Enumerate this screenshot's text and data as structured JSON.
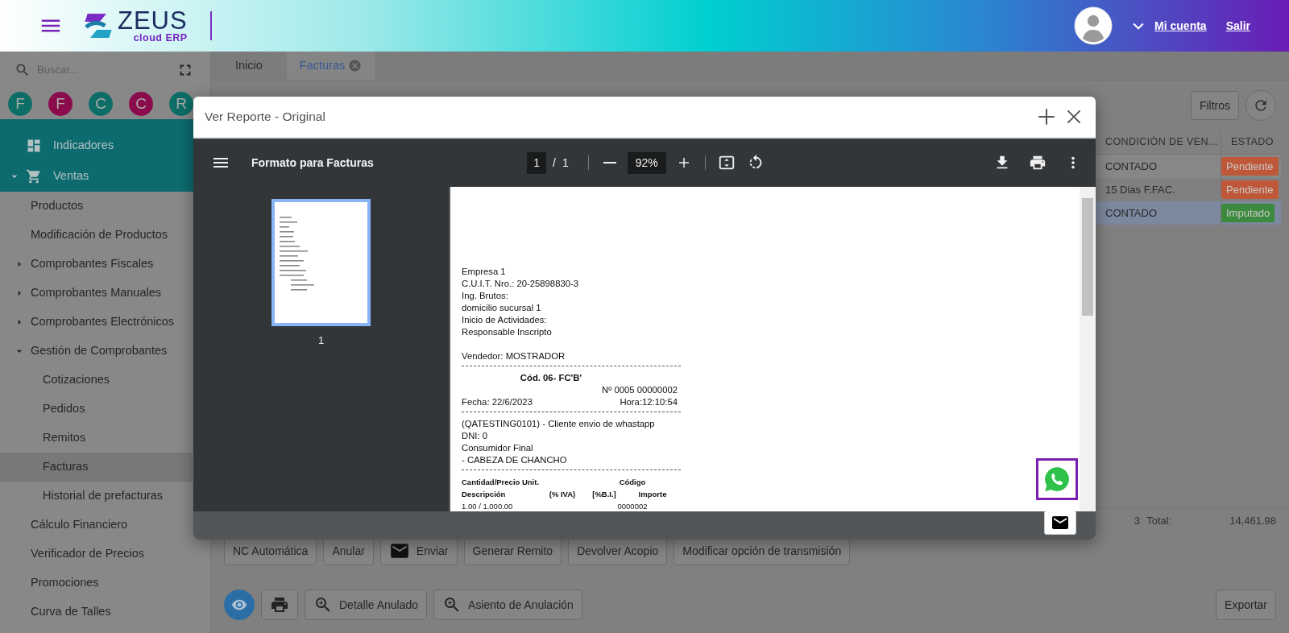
{
  "header": {
    "logo_word": "ZEUS",
    "logo_sub": "cloud ERP",
    "account_label": "Mi cuenta",
    "logout_label": "Salir"
  },
  "sidebar": {
    "search": {
      "placeholder": "Buscar..."
    },
    "shortcuts": [
      {
        "letter": "F",
        "color": "#0d6e67"
      },
      {
        "letter": "F",
        "color": "#8a0c4c"
      },
      {
        "letter": "C",
        "color": "#0d6e67"
      },
      {
        "letter": "C",
        "color": "#8a0c4c"
      },
      {
        "letter": "R",
        "color": "#0d6e67"
      }
    ],
    "menu": [
      {
        "label": "Indicadores",
        "selected": false
      },
      {
        "label": "Ventas",
        "selected": false,
        "expanded": true,
        "children": [
          {
            "label": "Productos",
            "selected": false
          },
          {
            "label": "Modificación de Productos",
            "selected": false
          },
          {
            "label": "Comprobantes Fiscales",
            "selected": false,
            "expanded": false
          },
          {
            "label": "Comprobantes Manuales",
            "selected": false,
            "expanded": false
          },
          {
            "label": "Comprobantes Electrónicos",
            "selected": false,
            "expanded": false
          },
          {
            "label": "Gestión de Comprobantes",
            "selected": false,
            "expanded": true,
            "children": [
              {
                "label": "Cotizaciones",
                "selected": false
              },
              {
                "label": "Pedidos",
                "selected": false
              },
              {
                "label": "Remitos",
                "selected": false
              },
              {
                "label": "Facturas",
                "selected": true
              },
              {
                "label": "Historial de prefacturas",
                "selected": false
              }
            ]
          },
          {
            "label": "Cálculo Financiero",
            "selected": false
          },
          {
            "label": "Verificador de Precios",
            "selected": false
          },
          {
            "label": "Promociones",
            "selected": false
          },
          {
            "label": "Curva de Talles",
            "selected": false
          }
        ]
      }
    ]
  },
  "tabs": [
    {
      "label": "Inicio",
      "selected": false,
      "closable": false
    },
    {
      "label": "Facturas",
      "selected": true,
      "closable": true
    }
  ],
  "filters_label": "Filtros",
  "table": {
    "columns": [
      "CONDICIÓN DE VEN...",
      "ESTADO"
    ],
    "rows": [
      {
        "condition": "CONTADO",
        "status": "Pendiente",
        "color": "#bf5838",
        "selected": false
      },
      {
        "condition": "15 Dias F.FAC.",
        "status": "Pendiente",
        "color": "#bf5838",
        "selected": false
      },
      {
        "condition": "CONTADO",
        "status": "Imputado",
        "color": "#3c8a3e",
        "selected": true
      }
    ]
  },
  "summary": {
    "count": "3",
    "total_label": "Total:",
    "total": "14,461.98"
  },
  "actions": [
    {
      "kind": "text",
      "label": "NC Automática"
    },
    {
      "kind": "text",
      "label": "Anular"
    },
    {
      "kind": "icon-text",
      "label": "Enviar"
    },
    {
      "kind": "text",
      "label": "Generar Remito"
    },
    {
      "kind": "text",
      "label": "Devolver Acopio"
    },
    {
      "kind": "text",
      "label": "Modificar opción de transmisión"
    }
  ],
  "actions_2": [
    {
      "kind": "round"
    },
    {
      "kind": "icon"
    },
    {
      "kind": "icon-text",
      "label": "Detalle Anulado"
    },
    {
      "kind": "icon-text",
      "label": "Asiento de Anulación"
    }
  ],
  "export_label": "Exportar",
  "modal": {
    "title": "Ver Reporte - Original",
    "viewer": {
      "document_title": "Formato para Facturas",
      "page": "1",
      "page_separator": "/",
      "page_count": "1",
      "zoom": "92%",
      "thumbnails": [
        {
          "label": "1",
          "selected": true
        }
      ],
      "document": [
        {
          "kind": "line",
          "text": "Empresa 1"
        },
        {
          "kind": "line",
          "text": "C.U.I.T. Nro.: 20-25898830-3"
        },
        {
          "kind": "line",
          "text": "Ing. Brutos:"
        },
        {
          "kind": "line",
          "text": "domicilio sucursal 1"
        },
        {
          "kind": "line",
          "text": "Inicio de Actividades:"
        },
        {
          "kind": "line",
          "text": "Responsable Inscripto"
        },
        {
          "kind": "gap"
        },
        {
          "kind": "line",
          "text": "Vendedor: MOSTRADOR"
        },
        {
          "kind": "rule"
        },
        {
          "kind": "title",
          "text": "Cód. 06- FC'B'"
        },
        {
          "kind": "right",
          "text": "Nº 0005 00000002"
        },
        {
          "kind": "pair",
          "cells": [
            "Fecha: 22/6/2023",
            "Hora:12:10:54"
          ]
        },
        {
          "kind": "rule"
        },
        {
          "kind": "line",
          "text": "(QATESTING0101) - Cliente envio de whastapp"
        },
        {
          "kind": "line",
          "text": "DNI: 0"
        },
        {
          "kind": "line",
          "text": "Consumidor Final"
        },
        {
          "kind": "line",
          "text": " - CABEZA DE CHANCHO"
        },
        {
          "kind": "rule"
        },
        {
          "kind": "heads",
          "cells": [
            "Cantidad/Precio Unit.",
            "Código"
          ]
        },
        {
          "kind": "heads",
          "cells": [
            "Descripción",
            "(% IVA)",
            "[%B.I.]",
            "Importe"
          ]
        },
        {
          "kind": "item",
          "cells": [
            "1.00 / 1.000.00",
            "0000002"
          ]
        }
      ]
    }
  }
}
